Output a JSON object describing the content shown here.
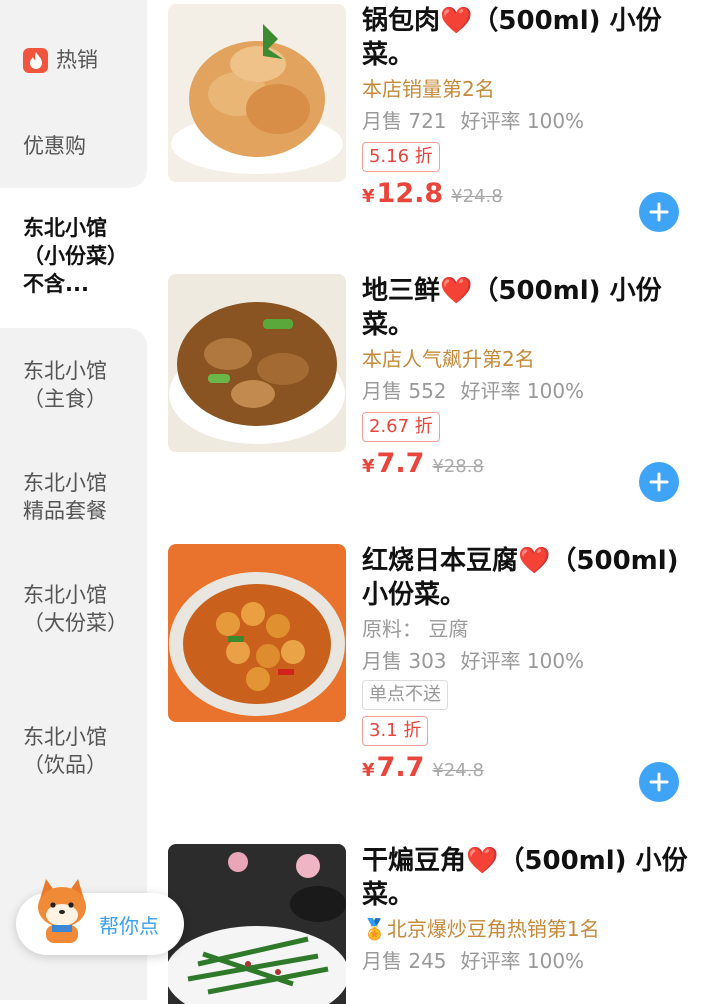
{
  "sidebar": {
    "categories": [
      {
        "label": "热销",
        "icon": "flame-icon"
      },
      {
        "label": "优惠购"
      },
      {
        "label": "东北小馆（小份菜）不含..."
      },
      {
        "label": "东北小馆（主食）"
      },
      {
        "label": "东北小馆精品套餐"
      },
      {
        "label": "东北小馆（大份菜）"
      },
      {
        "label": "东北小馆（饮品）"
      }
    ],
    "selected_index": 2
  },
  "items": [
    {
      "name": "锅包肉",
      "heart": "❤️",
      "suffix": "（500ml) 小份菜。",
      "tag": "本店销量第2名",
      "monthly_sales": "月售 721",
      "rating": "好评率 100%",
      "discount": "5.16 折",
      "currency": "¥",
      "price": "12.8",
      "original_price": "¥24.8"
    },
    {
      "name": "地三鲜",
      "heart": "❤️",
      "suffix": "（500ml) 小份菜。",
      "tag": "本店人气飙升第2名",
      "monthly_sales": "月售 552",
      "rating": "好评率 100%",
      "discount": "2.67 折",
      "currency": "¥",
      "price": "7.7",
      "original_price": "¥28.8"
    },
    {
      "name": "红烧日本豆腐",
      "heart": "❤️",
      "suffix": "（500ml) 小份菜。",
      "ingredients": "原料：  豆腐",
      "monthly_sales": "月售 303",
      "rating": "好评率 100%",
      "no_single_delivery": "单点不送",
      "discount": "3.1 折",
      "currency": "¥",
      "price": "7.7",
      "original_price": "¥24.8"
    },
    {
      "name": "干煸豆角",
      "heart": "❤️",
      "suffix": "（500ml) 小份菜。",
      "tag": "北京爆炒豆角热销第1名",
      "tag_icon": "medal-icon",
      "monthly_sales": "月售 245",
      "rating": "好评率 100%"
    }
  ],
  "helper": {
    "label": "帮你点",
    "icon": "shiba-mascot-icon"
  },
  "colors": {
    "accent_red": "#e8453c",
    "gold_tag": "#c58a3a",
    "add_button_blue": "#3fa4f5",
    "sidebar_bg": "#f2f2f2"
  }
}
